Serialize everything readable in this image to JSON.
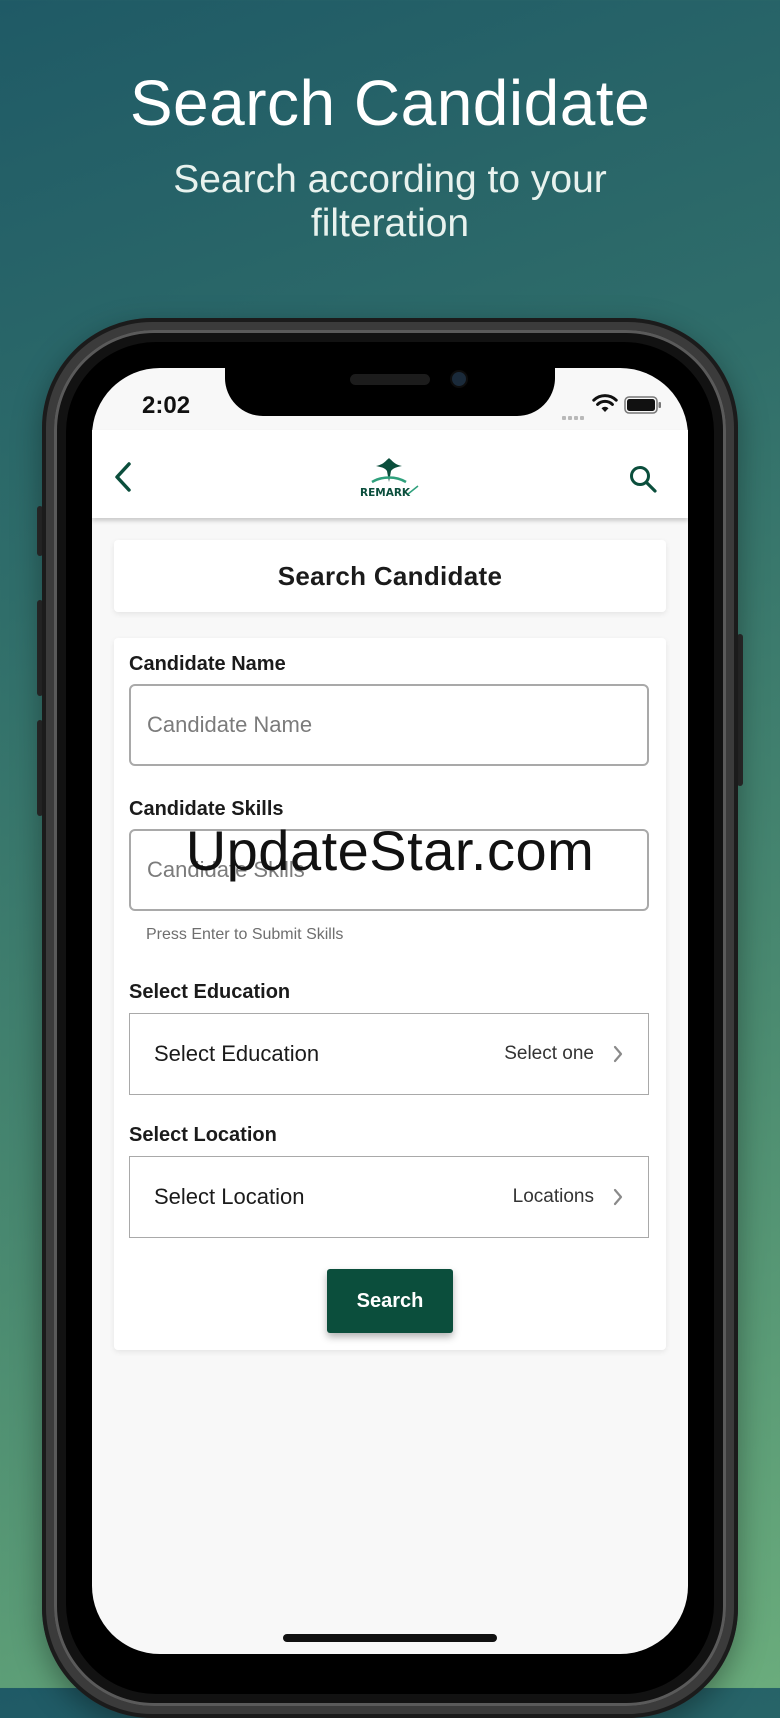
{
  "promo": {
    "headline": "Search Candidate",
    "subheadline": "Search according to your filteration"
  },
  "status_bar": {
    "time": "2:02"
  },
  "nav": {
    "logo_text": "REMARK",
    "back_icon": "chevron-left-icon",
    "search_icon": "search-icon"
  },
  "page": {
    "title": "Search Candidate"
  },
  "form": {
    "name": {
      "label": "Candidate Name",
      "placeholder": "Candidate Name"
    },
    "skills": {
      "label": "Candidate Skills",
      "placeholder": "Candidate Skills",
      "helper": "Press Enter to Submit Skills"
    },
    "education": {
      "label": "Select Education",
      "title": "Select Education",
      "value": "Select one"
    },
    "location": {
      "label": "Select Location",
      "title": "Select Location",
      "value": "Locations"
    },
    "submit_label": "Search"
  },
  "watermark": "UpdateStar.com",
  "colors": {
    "brand": "#0b4e3c",
    "background_top": "#1f5a66",
    "background_bottom": "#6aac7c"
  }
}
